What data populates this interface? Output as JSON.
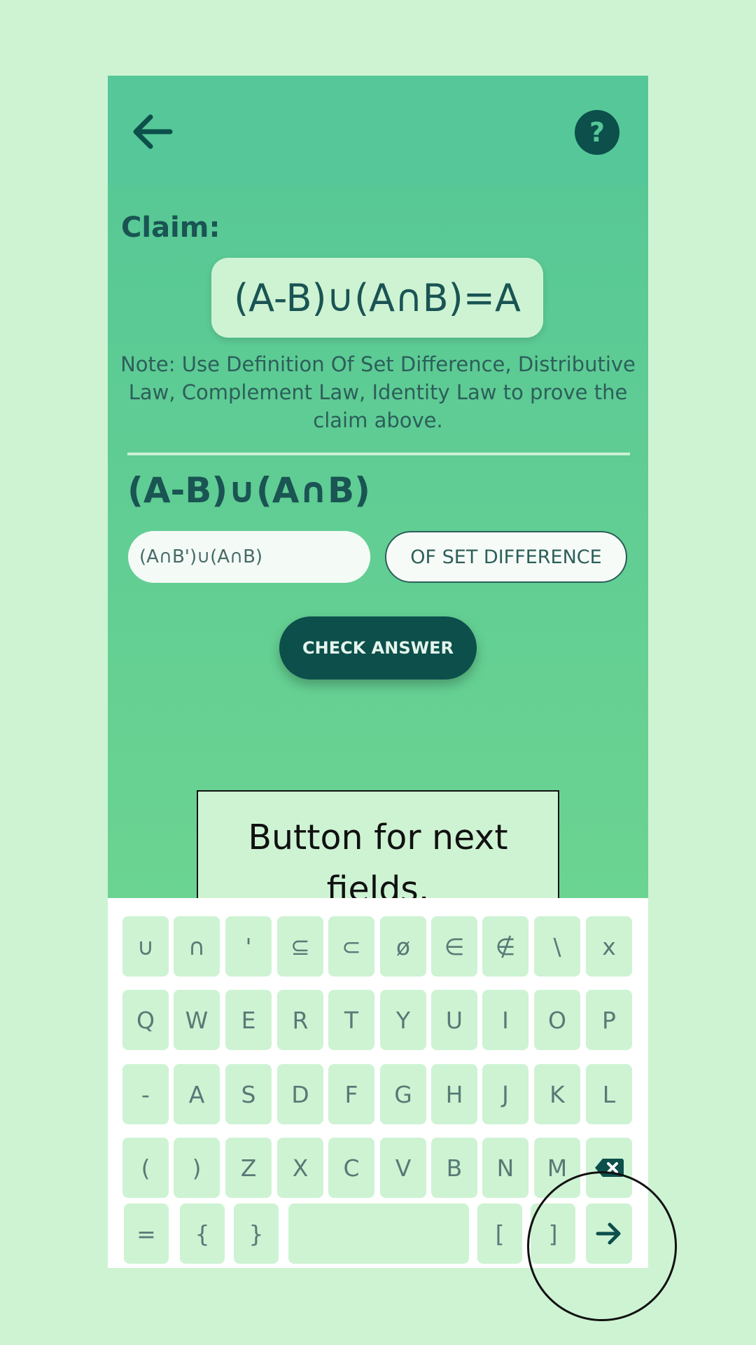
{
  "appbar": {
    "back_icon": "arrow-left-icon",
    "help_label": "?"
  },
  "claim": {
    "label": "Claim:",
    "expression": "(A-B)∪(A∩B)=A",
    "note": "Note: Use Definition Of Set Difference, Distributive Law, Complement Law, Identity Law to prove the claim above."
  },
  "step": {
    "expression": "(A-B)∪(A∩B)",
    "answer_value": "(A∩B')∪(A∩B)",
    "law_selected": "OF SET DIFFERENCE"
  },
  "check_button_label": "CHECK ANSWER",
  "hint_text": "Button for next fields.",
  "keyboard": {
    "row1": [
      "∪",
      "∩",
      "'",
      "⊆",
      "⊂",
      "ø",
      "∈",
      "∉",
      "\\",
      "x"
    ],
    "row2": [
      "Q",
      "W",
      "E",
      "R",
      "T",
      "Y",
      "U",
      "I",
      "O",
      "P"
    ],
    "row3": [
      "-",
      "A",
      "S",
      "D",
      "F",
      "G",
      "H",
      "J",
      "K",
      "L"
    ],
    "row4": [
      "(",
      ")",
      "Z",
      "X",
      "C",
      "V",
      "B",
      "N",
      "M"
    ],
    "row5": [
      "=",
      "{",
      "}",
      "",
      "[",
      "]"
    ],
    "backspace_icon": "backspace-icon",
    "next_icon": "arrow-right-icon"
  },
  "colors": {
    "header": "#56c799",
    "dark_teal": "#0c4f4b",
    "light_mint": "#cdf3d3"
  }
}
